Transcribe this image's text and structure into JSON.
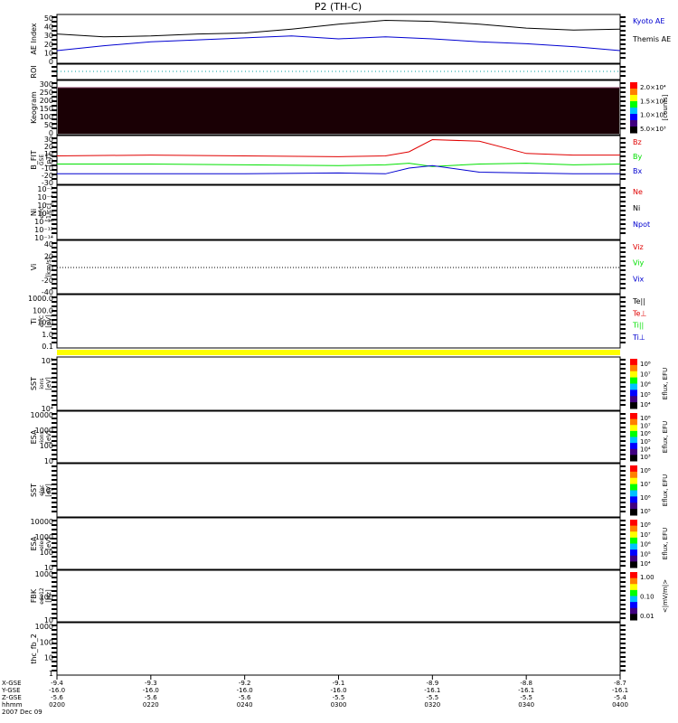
{
  "title": "P2 (TH-C)",
  "colors": {
    "red": "#e00000",
    "green": "#00e000",
    "blue": "#0000d0",
    "yellow": "#ffff00",
    "black": "#000000"
  },
  "x_axis": {
    "ticks": [
      {
        "x": "-9.4",
        "y": "-16.0",
        "z": "-5.6",
        "hhmm": "0200"
      },
      {
        "x": "-9.3",
        "y": "-16.0",
        "z": "-5.6",
        "hhmm": "0220"
      },
      {
        "x": "-9.2",
        "y": "-16.0",
        "z": "-5.6",
        "hhmm": "0240"
      },
      {
        "x": "-9.1",
        "y": "-16.0",
        "z": "-5.5",
        "hhmm": "0300"
      },
      {
        "x": "-8.9",
        "y": "-16.1",
        "z": "-5.5",
        "hhmm": "0320"
      },
      {
        "x": "-8.8",
        "y": "-16.1",
        "z": "-5.5",
        "hhmm": "0340"
      },
      {
        "x": "-8.7",
        "y": "-16.1",
        "z": "-5.4",
        "hhmm": "0400"
      }
    ],
    "row_labels": [
      "X-GSE",
      "Y-GSE",
      "Z-GSE",
      "hhmm",
      "2007 Dec 09"
    ]
  },
  "panels": [
    {
      "key": "ae",
      "ylabel": "AE Index",
      "ticks": [
        "50",
        "40",
        "30",
        "20",
        "10",
        "0"
      ],
      "legend": [
        {
          "text": "Kyoto AE",
          "color": "#0000d0"
        },
        {
          "text": "Themis AE",
          "color": "#000000"
        }
      ]
    },
    {
      "key": "roi",
      "ylabel": "ROI",
      "ticks": [],
      "legend": []
    },
    {
      "key": "keogram",
      "ylabel": "Keogram",
      "ticks": [
        "300",
        "250",
        "200",
        "150",
        "100",
        "50",
        "0"
      ],
      "colorbar": {
        "labels": [
          "2.0×10⁴",
          "1.5×10⁴",
          "1.0×10⁴",
          "5.0×10³"
        ],
        "unit": "[counts]"
      }
    },
    {
      "key": "bfit",
      "ylabel": "B_FIT",
      "sub": "GSE",
      "unit": "[nT]",
      "ticks": [
        "30",
        "20",
        "10",
        "0",
        "-10",
        "-20",
        "-30"
      ],
      "legend": [
        {
          "text": "Bz",
          "color": "#e00000"
        },
        {
          "text": "By",
          "color": "#00e000"
        },
        {
          "text": "Bx",
          "color": "#0000d0"
        }
      ]
    },
    {
      "key": "ni",
      "ylabel": "Ni",
      "sub": "eiPC",
      "unit": "[1/cc]",
      "ticks": [
        "10⁻²",
        "10⁻⁴",
        "10⁻⁶",
        "10⁻⁸",
        "10⁻¹⁰",
        "10⁻¹²",
        "10⁻¹⁴"
      ],
      "legend": [
        {
          "text": "Ne",
          "color": "#e00000"
        },
        {
          "text": "Ni",
          "color": "#000000"
        },
        {
          "text": "Npot",
          "color": "#0000d0"
        }
      ]
    },
    {
      "key": "vi",
      "ylabel": "Vi",
      "unit": "[km/s]",
      "ticks": [
        "40",
        "20",
        "0",
        "-20",
        "-40"
      ],
      "legend": [
        {
          "text": "Viz",
          "color": "#e00000"
        },
        {
          "text": "Viy",
          "color": "#00e000"
        },
        {
          "text": "Vix",
          "color": "#0000d0"
        }
      ]
    },
    {
      "key": "ti",
      "ylabel": "Ti",
      "sub": "eiPC",
      "unit": "[eV]",
      "ticks": [
        "1000.0",
        "100.0",
        "10.0",
        "1.0",
        "0.1"
      ],
      "legend": [
        {
          "text": "Te||",
          "color": "#000000"
        },
        {
          "text": "Te⊥",
          "color": "#e00000"
        },
        {
          "text": "Ti||",
          "color": "#00e000"
        },
        {
          "text": "Ti⊥",
          "color": "#0000d0"
        }
      ]
    },
    {
      "key": "sst_i",
      "ylabel": "SST",
      "sub": "ions",
      "unit": "[eV]",
      "ticks": [
        "10⁵",
        "10⁴"
      ],
      "colorbar": {
        "labels": [
          "10⁸",
          "10⁷",
          "10⁶",
          "10⁵",
          "10⁴"
        ],
        "unit": "Eflux, EFU"
      }
    },
    {
      "key": "esa_i",
      "ylabel": "ESA",
      "sub": "ions",
      "unit": "[eV]",
      "ticks": [
        "10000",
        "1000",
        "100",
        "10"
      ],
      "colorbar": {
        "labels": [
          "10⁸",
          "10⁷",
          "10⁶",
          "10⁵",
          "10⁴",
          "10³"
        ],
        "unit": "Eflux, EFU"
      }
    },
    {
      "key": "sst_e",
      "ylabel": "SST",
      "sub": "elec",
      "unit": "[eV]",
      "ticks": [
        "10⁵"
      ],
      "colorbar": {
        "labels": [
          "10⁸",
          "10⁷",
          "10⁶",
          "10⁵"
        ],
        "unit": "Eflux, EFU"
      }
    },
    {
      "key": "esa_e",
      "ylabel": "ESA",
      "sub": "elec",
      "unit": "[eV]",
      "ticks": [
        "10000",
        "1000",
        "100",
        "10"
      ],
      "colorbar": {
        "labels": [
          "10⁸",
          "10⁷",
          "10⁶",
          "10⁵",
          "10⁴"
        ],
        "unit": "Eflux, EFU"
      }
    },
    {
      "key": "fbk",
      "ylabel": "FBK",
      "sub": "edc12",
      "unit": "[Hz]",
      "ticks": [
        "1000",
        "100",
        "10"
      ],
      "colorbar": {
        "labels": [
          "1.00",
          "0.10",
          "0.01"
        ],
        "unit": "<|mV/m|>"
      }
    },
    {
      "key": "fb2",
      "ylabel": "thc_fb_2",
      "ticks": [
        "1000",
        "100",
        "10",
        "1"
      ]
    }
  ],
  "chart_data": {
    "type": "line",
    "time_range": [
      "0200",
      "0400"
    ],
    "ae_index": {
      "ylim": [
        0,
        50
      ],
      "t": [
        "0200",
        "0210",
        "0220",
        "0230",
        "0240",
        "0250",
        "0300",
        "0310",
        "0320",
        "0330",
        "0340",
        "0350",
        "0400"
      ],
      "series": [
        {
          "name": "Themis AE",
          "values": [
            30,
            27,
            28,
            30,
            31,
            35,
            40,
            44,
            43,
            40,
            36,
            34,
            35
          ]
        },
        {
          "name": "Kyoto AE",
          "values": [
            13,
            18,
            22,
            24,
            26,
            28,
            25,
            27,
            25,
            22,
            20,
            17,
            13
          ]
        }
      ]
    },
    "b_fit": {
      "ylim": [
        -30,
        30
      ],
      "t": [
        "0200",
        "0220",
        "0240",
        "0300",
        "0310",
        "0315",
        "0320",
        "0330",
        "0340",
        "0350",
        "0400"
      ],
      "series": [
        {
          "name": "Bz",
          "values": [
            5,
            6,
            5,
            4,
            5,
            10,
            25,
            23,
            8,
            6,
            6
          ]
        },
        {
          "name": "By",
          "values": [
            -5,
            -5,
            -6,
            -7,
            -6,
            -4,
            -8,
            -5,
            -4,
            -6,
            -5
          ]
        },
        {
          "name": "Bx",
          "values": [
            -17,
            -17,
            -17,
            -16,
            -17,
            -10,
            -7,
            -15,
            -16,
            -17,
            -17
          ]
        }
      ]
    }
  }
}
